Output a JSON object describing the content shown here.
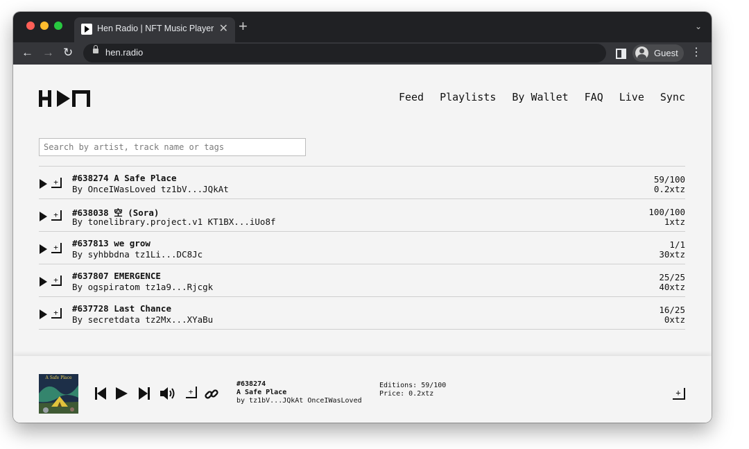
{
  "browser": {
    "tab_title": "Hen Radio | NFT Music Player",
    "tab_close": "✕",
    "new_tab": "+",
    "url": "hen.radio",
    "profile_label": "Guest"
  },
  "site": {
    "logo_text": "HEN",
    "nav": [
      "Feed",
      "Playlists",
      "By Wallet",
      "FAQ",
      "Live",
      "Sync"
    ],
    "search_placeholder": "Search by artist, track name or tags"
  },
  "tracks": [
    {
      "title": "#638274 A Safe Place",
      "by": "By OnceIWasLoved tz1bV...JQkAt",
      "editions": "59/100",
      "price": "0.2xtz"
    },
    {
      "title": "#638038 空 (Sora)",
      "by": "By tonelibrary.project.v1 KT1BX...iUo8f",
      "editions": "100/100",
      "price": "1xtz"
    },
    {
      "title": "#637813 we grow",
      "by": "By syhbbdna tz1Li...DC8Jc",
      "editions": "1/1",
      "price": "30xtz"
    },
    {
      "title": "#637807 EMERGENCE",
      "by": "By ogspiratom tz1a9...Rjcgk",
      "editions": "25/25",
      "price": "40xtz"
    },
    {
      "title": "#637728 Last Chance",
      "by": "By secretdata tz2Mx...XYaBu",
      "editions": "16/25",
      "price": "0xtz"
    }
  ],
  "player": {
    "cover_caption": "A Safe Place",
    "id": "#638274",
    "title": "A Safe Place",
    "by_line": "by tz1bV...JQkAt OnceIWasLoved",
    "editions": "Editions: 59/100",
    "price": "Price: 0.2xtz"
  },
  "icons": {
    "add_to_queue": "+",
    "collect": "+"
  }
}
